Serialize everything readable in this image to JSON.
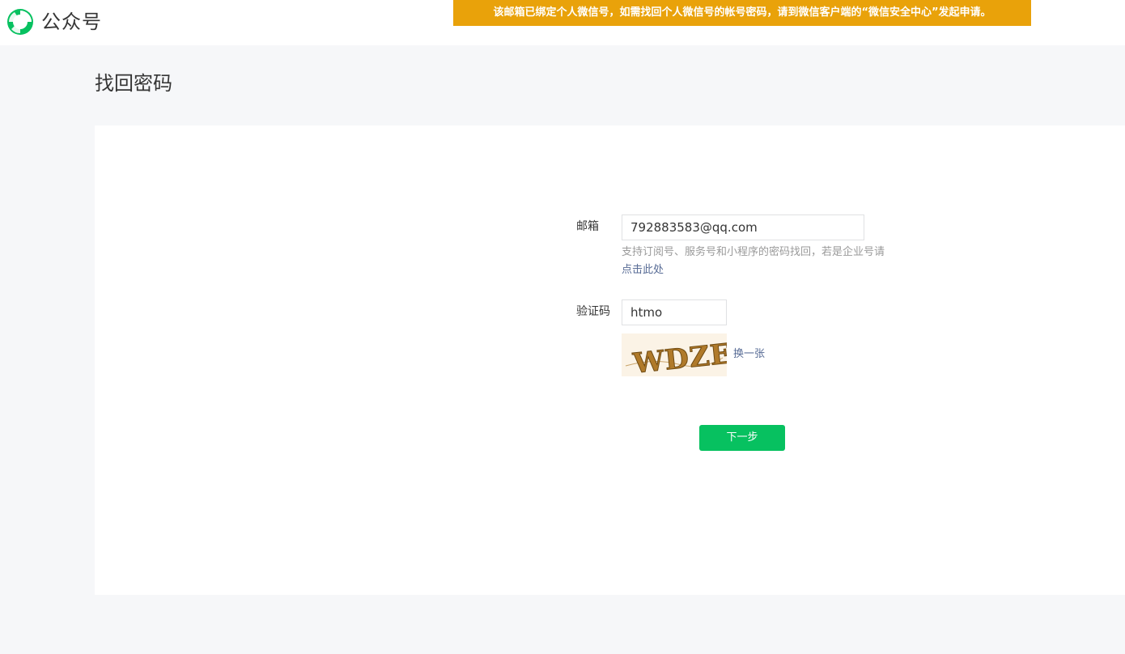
{
  "header": {
    "logo_text": "公众号",
    "notice": "该邮箱已绑定个人微信号，如需找回个人微信号的帐号密码，请到微信客户端的“微信安全中心”发起申请。"
  },
  "page": {
    "title": "找回密码"
  },
  "form": {
    "email": {
      "label": "邮箱",
      "value": "792883583@qq.com",
      "hint": "支持订阅号、服务号和小程序的密码找回，若是企业号请",
      "hint_link": "点击此处"
    },
    "captcha": {
      "label": "验证码",
      "value": "htmo",
      "image_text": "WDZE",
      "refresh_label": "换一张"
    },
    "next_label": "下一步"
  },
  "colors": {
    "brand_green": "#07c160",
    "notice_bg": "#e9a20a",
    "link": "#576b95"
  }
}
